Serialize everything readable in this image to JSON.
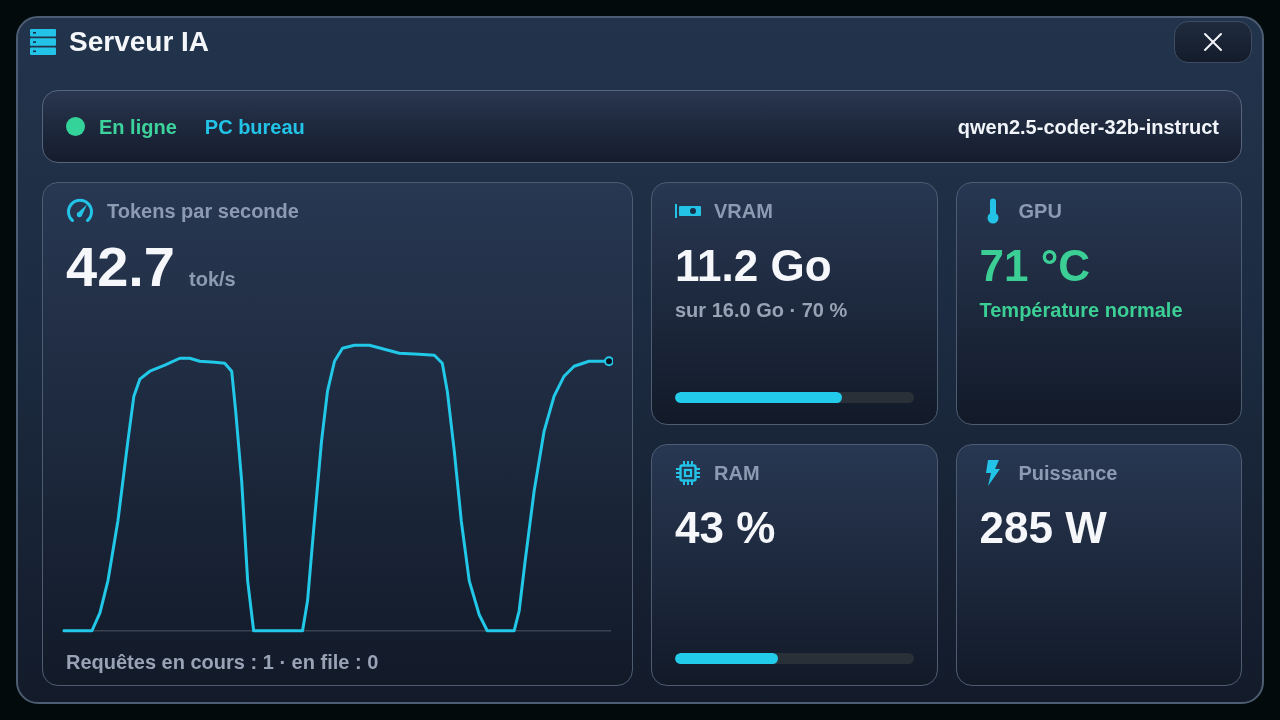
{
  "window": {
    "title": "Serveur IA"
  },
  "status": {
    "online": true,
    "label": "En ligne",
    "host": "PC bureau",
    "model": "qwen2.5-coder-32b-instruct"
  },
  "throughput": {
    "label": "Tokens par seconde",
    "value": "42.7",
    "unit": "tok/s",
    "footer": "Requêtes en cours : 1 · en file : 0"
  },
  "metrics": [
    {
      "kind": "vram",
      "label": "VRAM",
      "value": "11.2 Go",
      "detail": "sur 16.0 Go · 70 %",
      "accent": false,
      "level": 0.7
    },
    {
      "kind": "gpu",
      "label": "GPU",
      "value": "71 °C",
      "detail": "Température normale",
      "accent": true
    },
    {
      "kind": "ram",
      "label": "RAM",
      "value": "43 %",
      "accent": false,
      "level": 0.43
    },
    {
      "kind": "power",
      "label": "Puissance",
      "value": "285 W",
      "accent": false
    }
  ]
}
